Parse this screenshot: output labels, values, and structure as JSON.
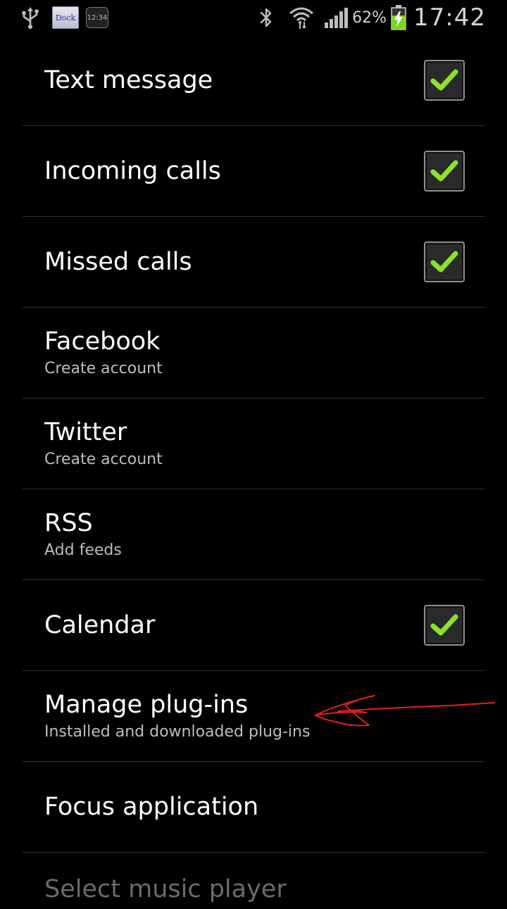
{
  "status_bar": {
    "notif_dock_label": "Dock",
    "notif_clock_label": "12:34",
    "battery_percent": "62%",
    "time": "17:42",
    "colors": {
      "battery_fill": "#7ed321",
      "icons": "#bdbdbd"
    }
  },
  "settings": {
    "items": [
      {
        "title": "Text message",
        "checked": true
      },
      {
        "title": "Incoming calls",
        "checked": true
      },
      {
        "title": "Missed calls",
        "checked": true
      },
      {
        "title": "Facebook",
        "summary": "Create account"
      },
      {
        "title": "Twitter",
        "summary": "Create account"
      },
      {
        "title": "RSS",
        "summary": "Add feeds"
      },
      {
        "title": "Calendar",
        "checked": true
      },
      {
        "title": "Manage plug-ins",
        "summary": "Installed and downloaded plug-ins"
      },
      {
        "title": "Focus application"
      },
      {
        "title": "Select music player"
      }
    ]
  },
  "colors": {
    "check_mark": "#8ee22a",
    "annotation_arrow": "#e0201e"
  }
}
